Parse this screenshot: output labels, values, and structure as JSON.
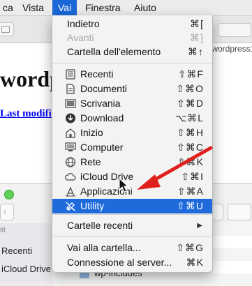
{
  "menubar": {
    "items": [
      {
        "label": "ca",
        "active": false
      },
      {
        "label": "Vista",
        "active": false
      },
      {
        "label": "Vai",
        "active": true
      },
      {
        "label": "Finestra",
        "active": false
      },
      {
        "label": "Aiuto",
        "active": false
      }
    ]
  },
  "browser": {
    "address_fragment": "/wordpress1",
    "heading": "wordp",
    "link": "Last modific"
  },
  "finder": {
    "sidebar_head": "iti",
    "sidebar_items": [
      "Recenti",
      "iCloud Drive"
    ],
    "folder": "wp-includes"
  },
  "menu": {
    "items": [
      {
        "label": "Indietro",
        "shortcut": "⌘[",
        "icon": null,
        "disabled": false
      },
      {
        "label": "Avanti",
        "shortcut": "⌘]",
        "icon": null,
        "disabled": true
      },
      {
        "label": "Cartella dell'elemento",
        "shortcut": "⌘↑",
        "icon": null,
        "disabled": false
      },
      {
        "label": "Recenti",
        "shortcut": "⇧⌘F",
        "icon": "recents-icon",
        "disabled": false
      },
      {
        "label": "Documenti",
        "shortcut": "⇧⌘O",
        "icon": "documents-icon",
        "disabled": false
      },
      {
        "label": "Scrivania",
        "shortcut": "⇧⌘D",
        "icon": "desktop-icon",
        "disabled": false
      },
      {
        "label": "Download",
        "shortcut": "⌥⌘L",
        "icon": "download-icon",
        "disabled": false
      },
      {
        "label": "Inizio",
        "shortcut": "⇧⌘H",
        "icon": "home-icon",
        "disabled": false
      },
      {
        "label": "Computer",
        "shortcut": "⇧⌘C",
        "icon": "computer-icon",
        "disabled": false
      },
      {
        "label": "Rete",
        "shortcut": "⇧⌘K",
        "icon": "network-icon",
        "disabled": false
      },
      {
        "label": "iCloud Drive",
        "shortcut": "⇧⌘I",
        "icon": "icloud-icon",
        "disabled": false
      },
      {
        "label": "Applicazioni",
        "shortcut": "⇧⌘A",
        "icon": "applications-icon",
        "disabled": false
      },
      {
        "label": "Utility",
        "shortcut": "⇧⌘U",
        "icon": "utilities-icon",
        "disabled": false,
        "selected": true
      },
      {
        "label": "Cartelle recenti",
        "submenu_arrow": "▶"
      },
      {
        "label": "Vai alla cartella...",
        "shortcut": "⇧⌘G"
      },
      {
        "label": "Connessione al server...",
        "shortcut": "⌘K"
      }
    ]
  },
  "colors": {
    "selection": "#1f6bdc",
    "annotation_arrow": "#e0201c"
  }
}
